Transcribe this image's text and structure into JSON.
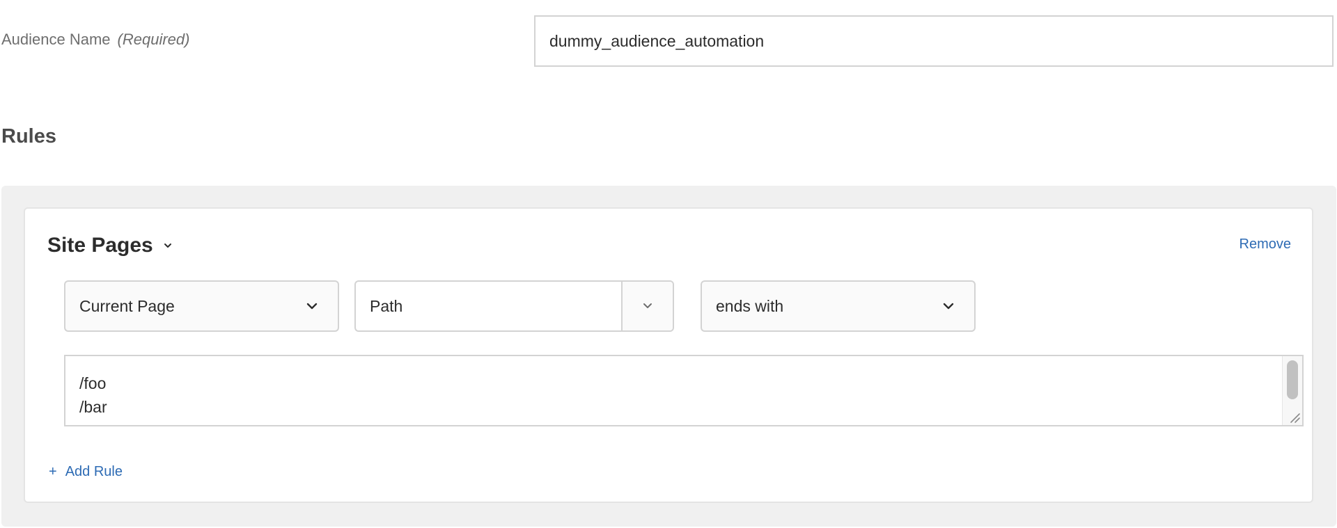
{
  "audience": {
    "label": "Audience Name",
    "required_label": "(Required)",
    "value": "dummy_audience_automation"
  },
  "rules": {
    "title": "Rules",
    "card": {
      "title": "Site Pages",
      "remove_label": "Remove",
      "selects": {
        "scope": "Current Page",
        "attribute": "Path",
        "operator": "ends with"
      },
      "values_text": "/foo\n/bar",
      "add_rule_label": "Add Rule",
      "add_rule_icon": "+"
    }
  },
  "colors": {
    "link": "#2d6bb4",
    "panel_bg": "#f0f0f0",
    "border": "#d3d3d3"
  }
}
